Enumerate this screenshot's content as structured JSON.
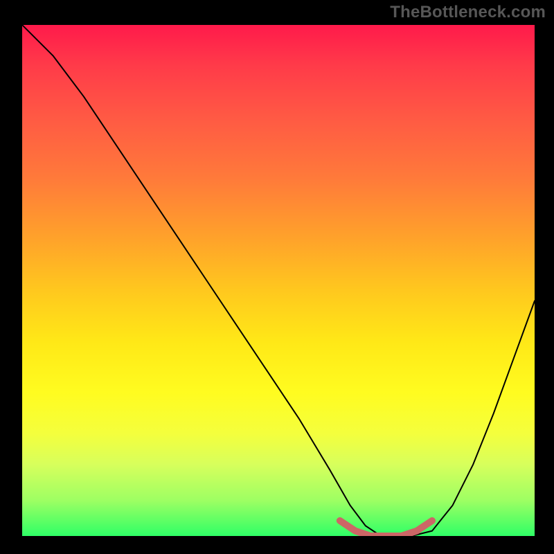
{
  "watermark": "TheBottleneck.com",
  "chart_data": {
    "type": "line",
    "title": "",
    "xlabel": "",
    "ylabel": "",
    "xlim": [
      0,
      100
    ],
    "ylim": [
      0,
      100
    ],
    "grid": false,
    "legend": false,
    "series": [
      {
        "name": "main-curve",
        "color": "#000000",
        "x": [
          0,
          6,
          12,
          18,
          24,
          30,
          36,
          42,
          48,
          54,
          60,
          64,
          67,
          70,
          73,
          76,
          80,
          84,
          88,
          92,
          96,
          100
        ],
        "values": [
          100,
          94,
          86,
          77,
          68,
          59,
          50,
          41,
          32,
          23,
          13,
          6,
          2,
          0,
          0,
          0,
          1,
          6,
          14,
          24,
          35,
          46
        ]
      },
      {
        "name": "trough-marker",
        "color": "#cc6666",
        "x": [
          62,
          65,
          68,
          71,
          74,
          77,
          80
        ],
        "values": [
          3,
          1,
          0,
          0,
          0,
          1,
          3
        ]
      }
    ],
    "background_gradient": {
      "direction": "top-to-bottom",
      "stops": [
        {
          "pos": 0.0,
          "color": "#ff1a4b"
        },
        {
          "pos": 0.08,
          "color": "#ff3b49"
        },
        {
          "pos": 0.18,
          "color": "#ff5944"
        },
        {
          "pos": 0.3,
          "color": "#ff7a3a"
        },
        {
          "pos": 0.42,
          "color": "#ffa32a"
        },
        {
          "pos": 0.52,
          "color": "#ffc81e"
        },
        {
          "pos": 0.62,
          "color": "#ffe817"
        },
        {
          "pos": 0.72,
          "color": "#fffc20"
        },
        {
          "pos": 0.8,
          "color": "#f4ff3d"
        },
        {
          "pos": 0.86,
          "color": "#d7ff5c"
        },
        {
          "pos": 0.93,
          "color": "#9eff63"
        },
        {
          "pos": 1.0,
          "color": "#2fff66"
        }
      ]
    }
  }
}
